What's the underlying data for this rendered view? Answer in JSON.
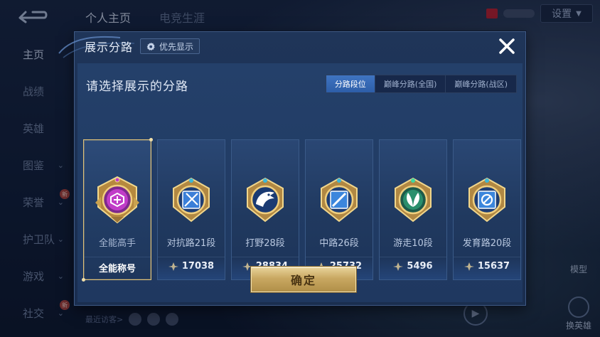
{
  "background": {
    "top_tabs": [
      {
        "label": "个人主页",
        "active": true
      },
      {
        "label": "电竞生涯",
        "active": false
      }
    ],
    "settings_label": "设置",
    "sidebar": [
      {
        "label": "主页",
        "active": true,
        "chevron": false,
        "new": false
      },
      {
        "label": "战绩",
        "active": false,
        "chevron": false,
        "new": false
      },
      {
        "label": "英雄",
        "active": false,
        "chevron": false,
        "new": false
      },
      {
        "label": "图鉴",
        "active": false,
        "chevron": true,
        "new": false
      },
      {
        "label": "荣誉",
        "active": false,
        "chevron": true,
        "new": true
      },
      {
        "label": "护卫队",
        "active": false,
        "chevron": true,
        "new": false
      },
      {
        "label": "游戏",
        "active": false,
        "chevron": true,
        "new": false
      },
      {
        "label": "社交",
        "active": false,
        "chevron": true,
        "new": true
      }
    ],
    "new_badge": "新",
    "recent_visitors_label": "最近访客>",
    "model_label": "模型",
    "swap_hero_label": "换英雄"
  },
  "modal": {
    "title": "展示分路",
    "pref_button": "优先显示",
    "prompt": "请选择展示的分路",
    "segments": [
      {
        "label": "分路段位",
        "active": true
      },
      {
        "label": "巅峰分路(全国)",
        "active": false
      },
      {
        "label": "巅峰分路(战区)",
        "active": false
      }
    ],
    "cards": [
      {
        "title": "全能高手",
        "stat": "全能称号",
        "points": false,
        "selected": true,
        "emblem": "allround-emblem-icon",
        "gem": "#c13cc8"
      },
      {
        "title": "对抗路21段",
        "stat": "17038",
        "points": true,
        "selected": false,
        "emblem": "clash-lane-emblem-icon",
        "gem": "#3b7fd8"
      },
      {
        "title": "打野28段",
        "stat": "28834",
        "points": true,
        "selected": false,
        "emblem": "jungle-emblem-icon",
        "gem": "#2a5fb8"
      },
      {
        "title": "中路26段",
        "stat": "25732",
        "points": true,
        "selected": false,
        "emblem": "mid-lane-emblem-icon",
        "gem": "#3c86dc"
      },
      {
        "title": "游走10段",
        "stat": "5496",
        "points": true,
        "selected": false,
        "emblem": "roam-emblem-icon",
        "gem": "#2a8f6c"
      },
      {
        "title": "发育路20段",
        "stat": "15637",
        "points": true,
        "selected": false,
        "emblem": "farm-lane-emblem-icon",
        "gem": "#3c86dc"
      }
    ],
    "confirm": "确定"
  },
  "colors": {
    "accent_gold": "#e3c479",
    "segment_active": "#3f74c2"
  }
}
